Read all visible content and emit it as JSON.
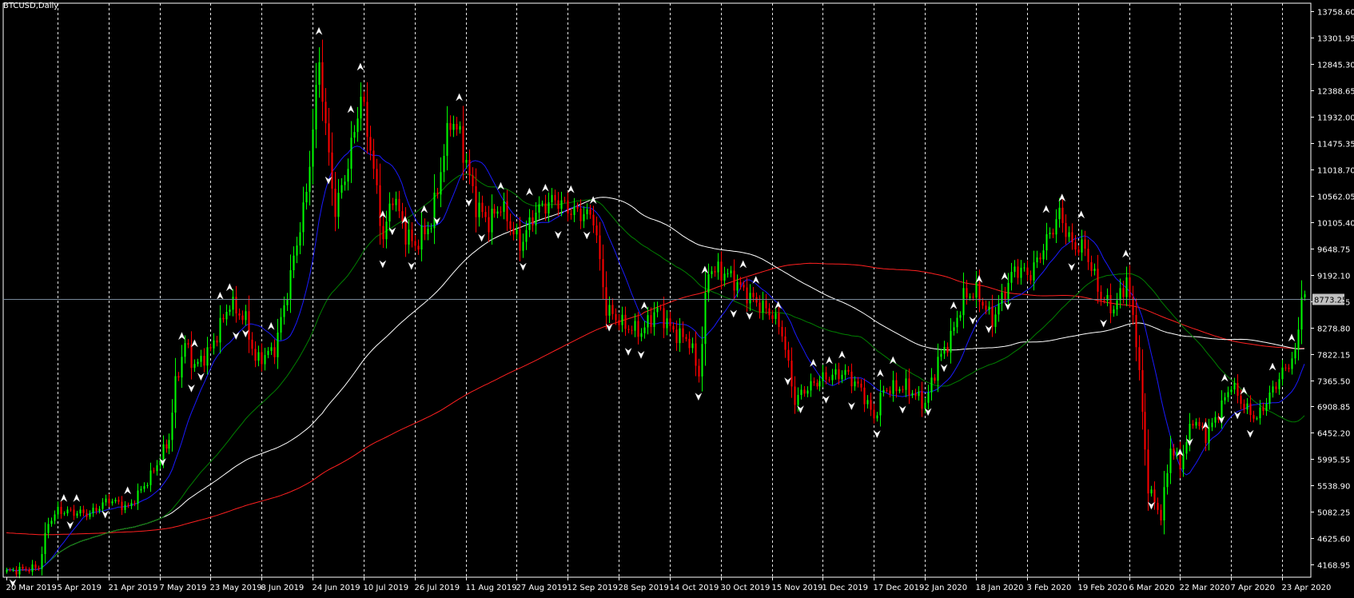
{
  "chart_data": {
    "type": "candlestick",
    "title": "BTCUSD,Daily",
    "colors": {
      "background": "#000000",
      "axis": "#ffffff",
      "grid": "#ffffff",
      "bull": "#00ff00",
      "bear": "#ff0000",
      "ma_fast": "#1a1aff",
      "ma_mid": "#008000",
      "ma_slow": "#ffffff",
      "ma_long": "#ff2020",
      "price_line": "#778899",
      "price_badge": "#c0c0c0"
    },
    "grid": "vertical-dashed",
    "ylim": [
      3950.0,
      13900.0
    ],
    "y_ticks": [
      "13758.60",
      "13301.95",
      "12845.30",
      "12388.65",
      "11932.00",
      "11475.35",
      "11018.70",
      "10562.05",
      "10105.40",
      "9648.75",
      "9192.10",
      "8735.45",
      "8278.80",
      "7822.15",
      "7365.50",
      "6908.85",
      "6452.20",
      "5995.55",
      "5538.90",
      "5082.25",
      "4625.60",
      "4168.95"
    ],
    "x_start": "2019-03-20",
    "x_end": "2020-04-30",
    "x_ticks": [
      {
        "date": "2019-03-20",
        "label": "20 Mar 2019"
      },
      {
        "date": "2019-04-05",
        "label": "5 Apr 2019"
      },
      {
        "date": "2019-04-21",
        "label": "21 Apr 2019"
      },
      {
        "date": "2019-05-07",
        "label": "7 May 2019"
      },
      {
        "date": "2019-05-23",
        "label": "23 May 2019"
      },
      {
        "date": "2019-06-08",
        "label": "8 Jun 2019"
      },
      {
        "date": "2019-06-24",
        "label": "24 Jun 2019"
      },
      {
        "date": "2019-07-10",
        "label": "10 Jul 2019"
      },
      {
        "date": "2019-07-26",
        "label": "26 Jul 2019"
      },
      {
        "date": "2019-08-11",
        "label": "11 Aug 2019"
      },
      {
        "date": "2019-08-27",
        "label": "27 Aug 2019"
      },
      {
        "date": "2019-09-12",
        "label": "12 Sep 2019"
      },
      {
        "date": "2019-09-28",
        "label": "28 Sep 2019"
      },
      {
        "date": "2019-10-14",
        "label": "14 Oct 2019"
      },
      {
        "date": "2019-10-30",
        "label": "30 Oct 2019"
      },
      {
        "date": "2019-11-15",
        "label": "15 Nov 2019"
      },
      {
        "date": "2019-12-01",
        "label": "1 Dec 2019"
      },
      {
        "date": "2019-12-17",
        "label": "17 Dec 2019"
      },
      {
        "date": "2020-01-02",
        "label": "2 Jan 2020"
      },
      {
        "date": "2020-01-18",
        "label": "18 Jan 2020"
      },
      {
        "date": "2020-02-03",
        "label": "3 Feb 2020"
      },
      {
        "date": "2020-02-19",
        "label": "19 Feb 2020"
      },
      {
        "date": "2020-03-06",
        "label": "6 Mar 2020"
      },
      {
        "date": "2020-03-22",
        "label": "22 Mar 2020"
      },
      {
        "date": "2020-04-07",
        "label": "7 Apr 2020"
      },
      {
        "date": "2020-04-23",
        "label": "23 Apr 2020"
      }
    ],
    "current_price": 8773.25,
    "current_price_label": "8773.25",
    "close_keypoints": [
      [
        "2019-03-20",
        4050
      ],
      [
        "2019-03-30",
        4120
      ],
      [
        "2019-04-02",
        4900
      ],
      [
        "2019-04-05",
        5100
      ],
      [
        "2019-04-15",
        5050
      ],
      [
        "2019-04-21",
        5300
      ],
      [
        "2019-04-27",
        5150
      ],
      [
        "2019-05-04",
        5700
      ],
      [
        "2019-05-10",
        6350
      ],
      [
        "2019-05-12",
        7300
      ],
      [
        "2019-05-15",
        8000
      ],
      [
        "2019-05-18",
        7600
      ],
      [
        "2019-05-23",
        7900
      ],
      [
        "2019-05-29",
        8700
      ],
      [
        "2019-06-03",
        8400
      ],
      [
        "2019-06-06",
        7700
      ],
      [
        "2019-06-12",
        7900
      ],
      [
        "2019-06-16",
        8900
      ],
      [
        "2019-06-22",
        10600
      ],
      [
        "2019-06-26",
        12900
      ],
      [
        "2019-06-29",
        11200
      ],
      [
        "2019-07-01",
        10300
      ],
      [
        "2019-07-05",
        11100
      ],
      [
        "2019-07-09",
        12300
      ],
      [
        "2019-07-12",
        11400
      ],
      [
        "2019-07-16",
        9800
      ],
      [
        "2019-07-19",
        10600
      ],
      [
        "2019-07-23",
        9900
      ],
      [
        "2019-07-26",
        9700
      ],
      [
        "2019-07-31",
        10100
      ],
      [
        "2019-08-03",
        11000
      ],
      [
        "2019-08-06",
        11900
      ],
      [
        "2019-08-09",
        11600
      ],
      [
        "2019-08-14",
        10400
      ],
      [
        "2019-08-18",
        10100
      ],
      [
        "2019-08-22",
        10400
      ],
      [
        "2019-08-28",
        9700
      ],
      [
        "2019-09-02",
        10300
      ],
      [
        "2019-09-08",
        10500
      ],
      [
        "2019-09-13",
        10300
      ],
      [
        "2019-09-20",
        10200
      ],
      [
        "2019-09-24",
        8600
      ],
      [
        "2019-09-30",
        8300
      ],
      [
        "2019-10-05",
        8200
      ],
      [
        "2019-10-10",
        8600
      ],
      [
        "2019-10-15",
        8200
      ],
      [
        "2019-10-20",
        8050
      ],
      [
        "2019-10-23",
        7450
      ],
      [
        "2019-10-25",
        8700
      ],
      [
        "2019-10-26",
        9300
      ],
      [
        "2019-11-01",
        9200
      ],
      [
        "2019-11-08",
        8800
      ],
      [
        "2019-11-15",
        8500
      ],
      [
        "2019-11-18",
        8200
      ],
      [
        "2019-11-22",
        7000
      ],
      [
        "2019-11-25",
        7200
      ],
      [
        "2019-12-01",
        7400
      ],
      [
        "2019-12-08",
        7500
      ],
      [
        "2019-12-13",
        7200
      ],
      [
        "2019-12-17",
        6700
      ],
      [
        "2019-12-20",
        7200
      ],
      [
        "2019-12-27",
        7250
      ],
      [
        "2020-01-02",
        6950
      ],
      [
        "2020-01-06",
        7700
      ],
      [
        "2020-01-10",
        8100
      ],
      [
        "2020-01-14",
        8800
      ],
      [
        "2020-01-18",
        8900
      ],
      [
        "2020-01-23",
        8400
      ],
      [
        "2020-01-30",
        9300
      ],
      [
        "2020-02-04",
        9200
      ],
      [
        "2020-02-10",
        9900
      ],
      [
        "2020-02-13",
        10250
      ],
      [
        "2020-02-17",
        9700
      ],
      [
        "2020-02-21",
        9650
      ],
      [
        "2020-02-26",
        8800
      ],
      [
        "2020-03-01",
        8600
      ],
      [
        "2020-03-05",
        9100
      ],
      [
        "2020-03-08",
        8100
      ],
      [
        "2020-03-12",
        5500
      ],
      [
        "2020-03-16",
        5000
      ],
      [
        "2020-03-19",
        6200
      ],
      [
        "2020-03-22",
        5900
      ],
      [
        "2020-03-26",
        6700
      ],
      [
        "2020-03-30",
        6400
      ],
      [
        "2020-04-03",
        6800
      ],
      [
        "2020-04-07",
        7300
      ],
      [
        "2020-04-11",
        6900
      ],
      [
        "2020-04-15",
        6700
      ],
      [
        "2020-04-19",
        7100
      ],
      [
        "2020-04-23",
        7500
      ],
      [
        "2020-04-27",
        7800
      ],
      [
        "2020-04-29",
        8800
      ]
    ],
    "fractal_up_dates": [
      "2019-04-07",
      "2019-04-11",
      "2019-04-27",
      "2019-05-14",
      "2019-05-18",
      "2019-05-26",
      "2019-05-29",
      "2019-06-11",
      "2019-06-26",
      "2019-07-06",
      "2019-07-09",
      "2019-07-16",
      "2019-07-23",
      "2019-07-29",
      "2019-08-09",
      "2019-08-22",
      "2019-08-31",
      "2019-09-05",
      "2019-09-13",
      "2019-09-20",
      "2019-10-06",
      "2019-10-25",
      "2019-11-06",
      "2019-11-10",
      "2019-11-17",
      "2019-11-28",
      "2019-12-03",
      "2019-12-07",
      "2019-12-19",
      "2019-12-23",
      "2020-01-11",
      "2020-01-19",
      "2020-01-27",
      "2020-02-09",
      "2020-02-14",
      "2020-02-20",
      "2020-03-05",
      "2020-03-22",
      "2020-03-30",
      "2020-04-05",
      "2020-04-11",
      "2020-04-20",
      "2020-04-26"
    ],
    "fractal_down_dates": [
      "2019-03-22",
      "2019-04-09",
      "2019-04-20",
      "2019-05-08",
      "2019-05-17",
      "2019-05-20",
      "2019-05-31",
      "2019-06-03",
      "2019-06-29",
      "2019-07-16",
      "2019-07-19",
      "2019-07-25",
      "2019-08-02",
      "2019-08-12",
      "2019-08-16",
      "2019-08-29",
      "2019-09-09",
      "2019-09-18",
      "2019-09-25",
      "2019-10-01",
      "2019-10-05",
      "2019-10-23",
      "2019-11-03",
      "2019-11-08",
      "2019-11-20",
      "2019-11-24",
      "2019-12-02",
      "2019-12-10",
      "2019-12-18",
      "2019-12-26",
      "2020-01-03",
      "2020-01-08",
      "2020-01-17",
      "2020-01-22",
      "2020-01-28",
      "2020-02-17",
      "2020-02-27",
      "2020-03-13",
      "2020-03-25",
      "2020-04-04",
      "2020-04-09",
      "2020-04-13"
    ]
  }
}
